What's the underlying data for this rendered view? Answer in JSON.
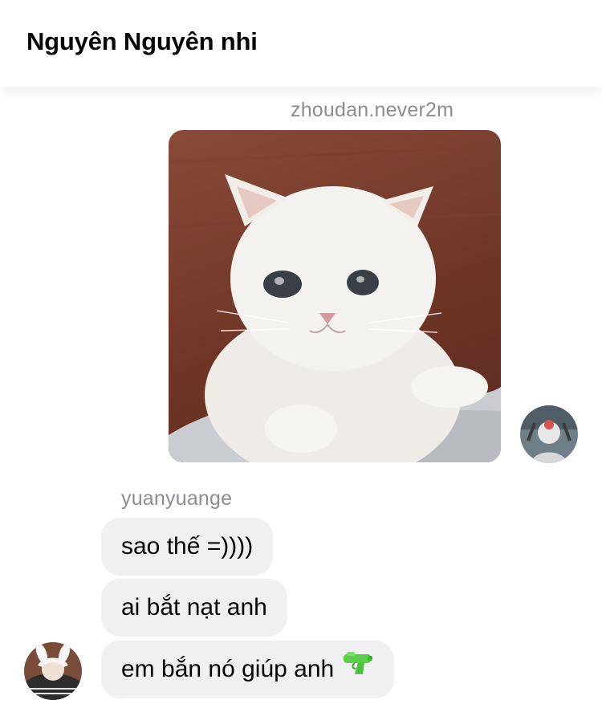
{
  "header": {
    "title": "Nguyên Nguyên nhi"
  },
  "messages": [
    {
      "sender": "zhoudan.never2m",
      "type": "image",
      "content": "sad white cat photo",
      "avatar": "user-avatar"
    },
    {
      "sender": "yuanyuange",
      "type": "text",
      "text": "sao thế =))))"
    },
    {
      "type": "text",
      "text": "ai bắt nạt anh"
    },
    {
      "type": "text",
      "text": "em bắn nó giúp anh",
      "emoji": "water-pistol-icon",
      "avatar": "user-avatar"
    }
  ],
  "colors": {
    "bubble": "#f0f0f2",
    "sender_name": "#8a8d91",
    "gun": "#5bd14a"
  }
}
